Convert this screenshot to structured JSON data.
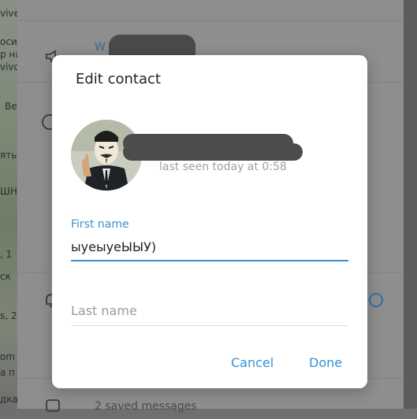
{
  "background": {
    "left_fragments": [
      "vive",
      "осит",
      "р на",
      "vivo",
      "Ве",
      "ять",
      "ШН",
      ", 1",
      "ск",
      "s, 2",
      "om",
      "а п",
      "дка"
    ],
    "link_text": "W",
    "bottom_text": "2 saved messages"
  },
  "dialog": {
    "title": "Edit contact",
    "status": "last seen today at 0:58",
    "first_name": {
      "label": "First name",
      "value": "ыуеыуеЫЫУ)"
    },
    "last_name": {
      "placeholder": "Last name",
      "value": ""
    },
    "cancel_label": "Cancel",
    "done_label": "Done"
  },
  "colors": {
    "accent": "#3a8fd0",
    "status_gray": "#9aa3ab",
    "dialog_bg": "#ffffff"
  },
  "icons": [
    "megaphone-icon",
    "info-icon",
    "bell-icon",
    "bookmark-icon",
    "avatar-image"
  ]
}
